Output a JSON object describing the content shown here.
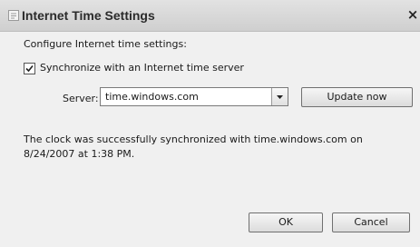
{
  "window": {
    "title": "Internet Time Settings",
    "close_label": "×"
  },
  "heading": "Configure Internet time settings:",
  "sync": {
    "checked": true,
    "label": "Synchronize with an Internet time server"
  },
  "server": {
    "label": "Server:",
    "value": "time.windows.com"
  },
  "buttons": {
    "update": "Update now",
    "ok": "OK",
    "cancel": "Cancel"
  },
  "status": {
    "line1": "The clock was successfully synchronized with time.windows.com on",
    "line2": "8/24/2007 at 1:38 PM."
  },
  "icons": {
    "title": "clock-icon",
    "close": "close-icon",
    "dropdown": "chevron-down-icon"
  }
}
